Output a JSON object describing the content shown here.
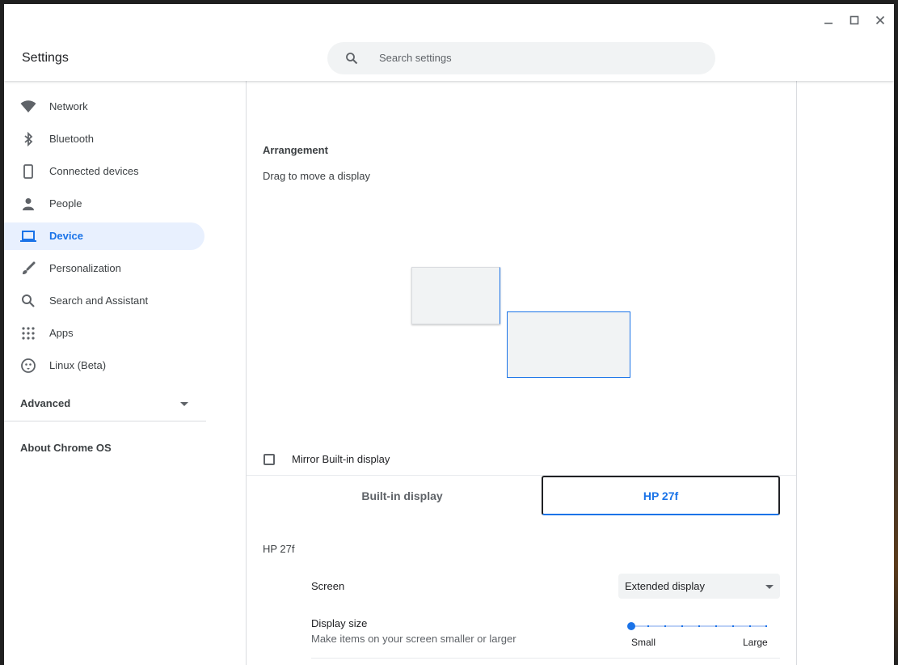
{
  "window": {
    "title": "Settings",
    "controls": [
      "minimize",
      "maximize",
      "close"
    ]
  },
  "search": {
    "placeholder": "Search settings"
  },
  "sidebar": {
    "items": [
      {
        "label": "Network",
        "icon": "wifi-icon"
      },
      {
        "label": "Bluetooth",
        "icon": "bluetooth-icon"
      },
      {
        "label": "Connected devices",
        "icon": "phone-icon"
      },
      {
        "label": "People",
        "icon": "person-icon"
      },
      {
        "label": "Device",
        "icon": "laptop-icon",
        "active": true
      },
      {
        "label": "Personalization",
        "icon": "brush-icon"
      },
      {
        "label": "Search and Assistant",
        "icon": "search-icon"
      },
      {
        "label": "Apps",
        "icon": "apps-grid-icon"
      },
      {
        "label": "Linux (Beta)",
        "icon": "linux-penguin-icon"
      }
    ],
    "advanced_label": "Advanced",
    "about_label": "About Chrome OS"
  },
  "display": {
    "arrangement_title": "Arrangement",
    "arrangement_subtitle": "Drag to move a display",
    "mirror_label": "Mirror Built-in display",
    "mirror_checked": false,
    "tabs": [
      {
        "label": "Built-in display",
        "selected": false
      },
      {
        "label": "HP 27f",
        "selected": true
      }
    ],
    "section_title": "HP 27f",
    "screen_label": "Screen",
    "screen_value": "Extended display",
    "display_size_label": "Display size",
    "display_size_sublabel": "Make items on your screen smaller or larger",
    "display_size_fraction": 0.0,
    "slider_min_label": "Small",
    "slider_max_label": "Large"
  },
  "colors": {
    "accent": "#1a73e8",
    "active_bg": "#e8f0fe"
  }
}
